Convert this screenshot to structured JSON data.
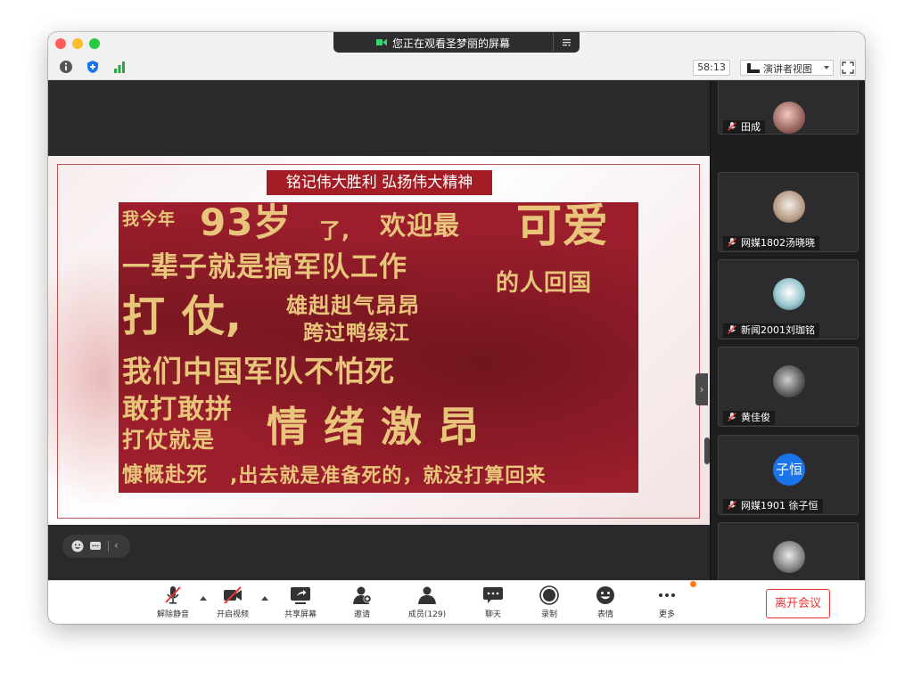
{
  "window": {
    "share_banner": "您正在观看圣梦丽的屏幕",
    "share_banner_icon": "screen-share-icon",
    "menu_icon": "collapse-menu-icon"
  },
  "toolbar": {
    "info_icon": "info-icon",
    "security_icon": "shield-icon",
    "signal_icon": "signal-bars-icon",
    "timer": "58:13",
    "view_label": "演讲者视图",
    "fullscreen_icon": "fullscreen-icon"
  },
  "shared_screen": {
    "headline": "铭记伟大胜利 弘扬伟大精神",
    "poster_lines": [
      "我今年",
      "93岁",
      "了,",
      "欢迎最",
      "可爱",
      "一辈子就是搞军队工作",
      "的人回国",
      "打 仗,",
      "雄赳赳气昂昂",
      "跨过鸭绿江",
      "我们中国军队不怕死",
      "敢打敢拼",
      "打仗就是",
      "情 绪 激 昂",
      "慷慨赴死",
      ",出去就是准备死的，就没打算回来"
    ],
    "poster_colors": {
      "background": "#9c1e2c",
      "text": "#e8c57a",
      "headline_bg": "#a51d24"
    }
  },
  "participants": [
    {
      "name": "田成",
      "muted": true,
      "avatar": "photo"
    },
    {
      "name": "网媒1802汤晓晓",
      "muted": true,
      "avatar": "photo"
    },
    {
      "name": "新闻2001刘珈铭",
      "muted": true,
      "avatar": "photo"
    },
    {
      "name": "黄佳俊",
      "muted": true,
      "avatar": "photo"
    },
    {
      "name": "网媒1901 徐子恒",
      "muted": true,
      "avatar": "initials",
      "initials": "子恒",
      "avatar_color": "#1a73e8"
    },
    {
      "name": "",
      "muted": true,
      "avatar": "photo"
    }
  ],
  "controls": {
    "items": [
      {
        "label": "解除静音",
        "icon": "mic-muted-icon"
      },
      {
        "label": "开启视频",
        "icon": "video-off-icon"
      },
      {
        "label": "共享屏幕",
        "icon": "share-screen-icon"
      },
      {
        "label": "邀请",
        "icon": "invite-icon"
      },
      {
        "label": "成员(129)",
        "icon": "members-icon"
      },
      {
        "label": "聊天",
        "icon": "chat-icon"
      },
      {
        "label": "录制",
        "icon": "record-icon"
      },
      {
        "label": "表情",
        "icon": "emoji-icon"
      },
      {
        "label": "更多",
        "icon": "more-icon"
      }
    ],
    "leave": "离开会议",
    "accent_color": "#e33333"
  }
}
